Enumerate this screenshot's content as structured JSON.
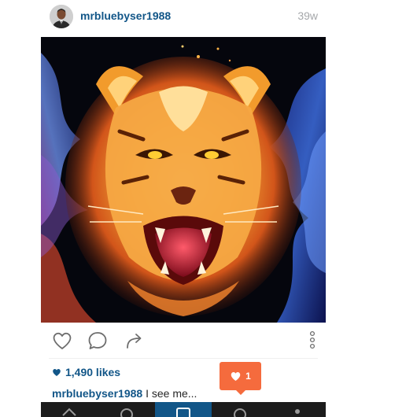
{
  "post": {
    "author": "mrbluebyser1988",
    "time_ago": "39w",
    "image_subject": "tiger-in-flames-image",
    "likes": {
      "count_label": "1,490 likes"
    },
    "caption": {
      "author": "mrbluebyser1988",
      "text": " I see me..."
    }
  },
  "actions": {
    "like_icon": "heart-outline-icon",
    "comment_icon": "comment-bubble-icon",
    "share_icon": "share-arrow-icon",
    "more_icon": "vertical-ellipsis-icon"
  },
  "notification": {
    "icon": "heart-icon",
    "count": "1"
  },
  "tabbar": {
    "tabs": [
      {
        "icon": "home-icon",
        "active": false
      },
      {
        "icon": "search-icon",
        "active": false
      },
      {
        "icon": "camera-icon",
        "active": true
      },
      {
        "icon": "activity-icon",
        "active": false
      },
      {
        "icon": "profile-icon",
        "active": false
      }
    ]
  },
  "colors": {
    "link_blue": "#125688",
    "timestamp_gray": "#a5a7aa",
    "notification_orange": "#f56b3d",
    "tabbar_dark": "#1c1c1c"
  }
}
